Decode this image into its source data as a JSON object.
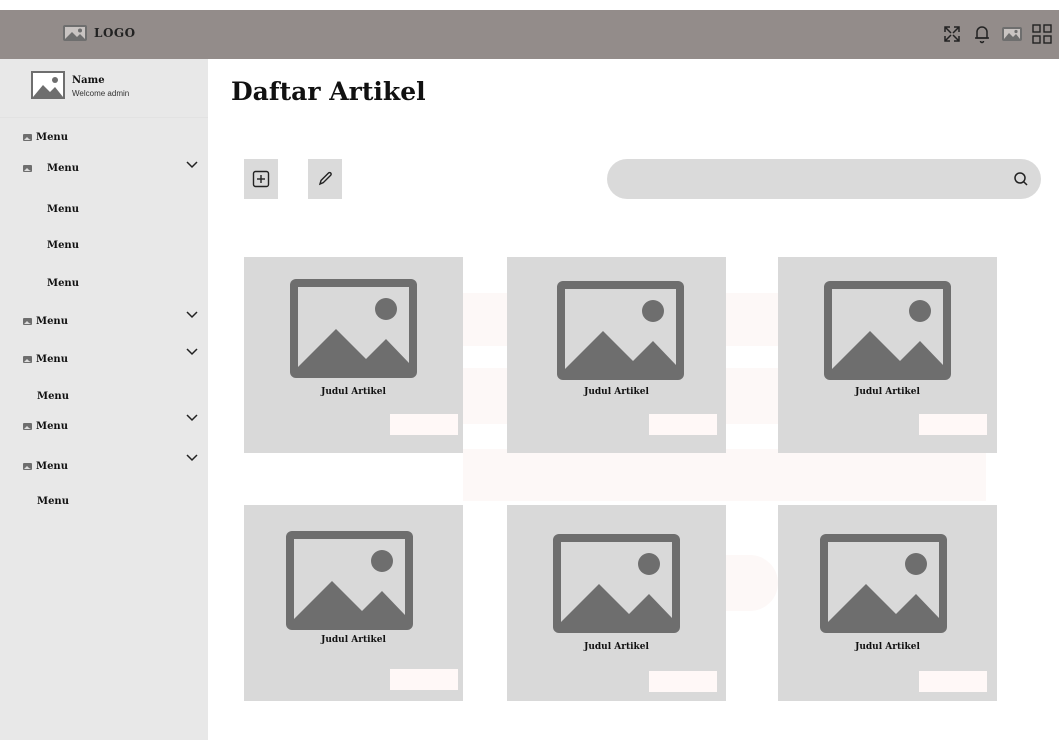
{
  "header": {
    "logo_text": "LOGO",
    "icons": [
      "collapse-arrows-icon",
      "bell-icon",
      "image-icon",
      "grid-icon"
    ]
  },
  "profile": {
    "name": "Name",
    "subtitle": "Welcome admin"
  },
  "sidebar": {
    "items": [
      {
        "label": "Menu"
      },
      {
        "label": "Menu",
        "expandable": true
      },
      {
        "label": "Menu"
      },
      {
        "label": "Menu"
      },
      {
        "label": "Menu"
      },
      {
        "label": "Menu",
        "expandable": true
      },
      {
        "label": "Menu",
        "expandable": true
      },
      {
        "label": "Menu"
      },
      {
        "label": "Menu",
        "expandable": true
      },
      {
        "label": "Menu",
        "expandable": true
      },
      {
        "label": "Menu"
      }
    ]
  },
  "main": {
    "title": "Daftar Artikel",
    "toolbar": {
      "add_icon": "plus-square-icon",
      "edit_icon": "pencil-icon"
    },
    "search": {
      "placeholder": "",
      "value": "",
      "icon": "search-icon"
    },
    "cards": [
      {
        "title": "Judul Artikel"
      },
      {
        "title": "Judul Artikel"
      },
      {
        "title": "Judul Artikel"
      },
      {
        "title": "Judul Artikel"
      },
      {
        "title": "Judul Artikel"
      },
      {
        "title": "Judul Artikel"
      }
    ]
  },
  "colors": {
    "header": "#938c8a",
    "sidebar": "#e8e8e8",
    "card": "#d9d9d9",
    "placeholder_image": "#6e6e6e",
    "card_button": "#fff8f7"
  }
}
